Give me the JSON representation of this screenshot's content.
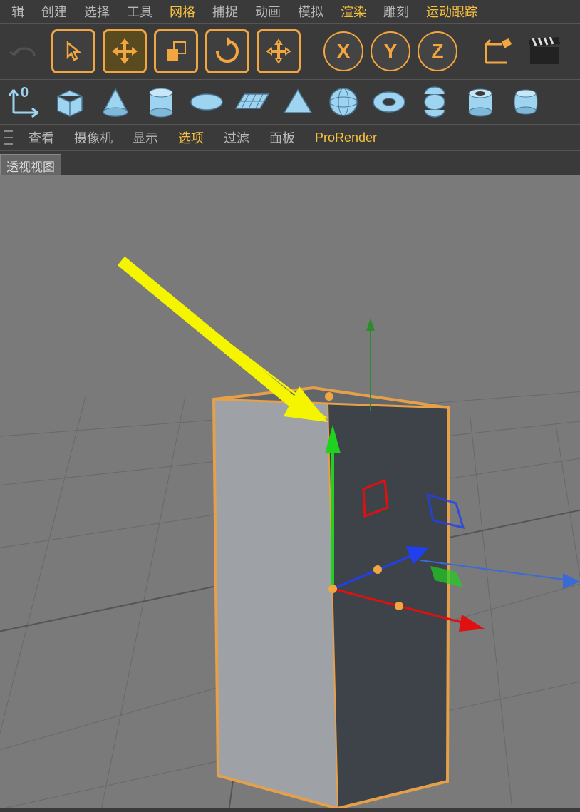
{
  "menu": {
    "items": [
      "辑",
      "创建",
      "选择",
      "工具",
      "网格",
      "捕捉",
      "动画",
      "模拟",
      "渲染",
      "雕刻",
      "运动跟踪"
    ],
    "highlighted": [
      4,
      8,
      10
    ]
  },
  "toolbar": {
    "undo": "undo-icon",
    "tools": [
      {
        "name": "select-tool",
        "icon": "cursor",
        "active": true
      },
      {
        "name": "move-tool",
        "icon": "move",
        "active": true,
        "yellow": true
      },
      {
        "name": "scale-tool",
        "icon": "scale",
        "active": true
      },
      {
        "name": "rotate-tool",
        "icon": "rotate",
        "active": true
      },
      {
        "name": "transform-tool",
        "icon": "move2",
        "active": true
      }
    ],
    "axes": [
      "X",
      "Y",
      "Z"
    ],
    "extras": [
      {
        "name": "coord-system",
        "icon": "axis-cube"
      },
      {
        "name": "clapper",
        "icon": "clapper"
      }
    ]
  },
  "primitives": {
    "coord": "coord-icon",
    "items": [
      "cube",
      "cone",
      "cylinder",
      "disc",
      "plane",
      "pyramid",
      "sphere",
      "torus",
      "capsule",
      "tube",
      "barrel"
    ]
  },
  "viewmenu": {
    "items": [
      "查看",
      "摄像机",
      "显示",
      "选项",
      "过滤",
      "面板",
      "ProRender"
    ],
    "highlighted": [
      3,
      6
    ]
  },
  "viewlabel": "透视视图",
  "viewport": {
    "object": "cube-primitive",
    "gizmo_axes": [
      "x-red",
      "y-green",
      "z-blue"
    ],
    "annotation": "yellow-arrow-pointing-to-top-edge"
  }
}
